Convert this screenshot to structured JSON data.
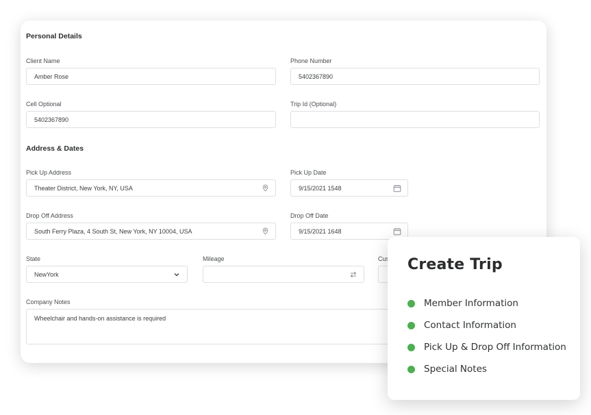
{
  "sections": {
    "personal": "Personal Details",
    "address": "Address & Dates"
  },
  "fields": {
    "client_name": {
      "label": "Client Name",
      "value": "Amber Rose"
    },
    "phone_number": {
      "label": "Phone Number",
      "value": "5402367890"
    },
    "cell_optional": {
      "label": "Cell Optional",
      "value": "5402367890"
    },
    "trip_id": {
      "label": "Trip Id (Optional)",
      "value": ""
    },
    "pickup_address": {
      "label": "Pick Up Address",
      "value": "Theater District, New York, NY, USA",
      "icon": "location-pin-icon"
    },
    "pickup_date": {
      "label": "Pick Up Date",
      "value": "9/15/2021 1548",
      "icon": "calendar-icon"
    },
    "dropoff_address": {
      "label": "Drop Off Address",
      "value": "South Ferry Plaza, 4 South St, New York, NY 10004, USA",
      "icon": "location-pin-icon"
    },
    "dropoff_date": {
      "label": "Drop Off Date",
      "value": "9/15/2021 1648",
      "icon": "calendar-icon"
    },
    "state": {
      "label": "State",
      "value": "NewYork",
      "icon": "chevron-down-icon"
    },
    "mileage": {
      "label": "Mileage",
      "value": "",
      "icon": "swap-icon"
    },
    "partial_field": {
      "label": "Cus",
      "value": ""
    },
    "company_notes": {
      "label": "Company Notes",
      "value": "Wheelchair and hands-on assistance is required"
    }
  },
  "popup": {
    "title": "Create Trip",
    "steps": [
      {
        "label": "Member Information"
      },
      {
        "label": "Contact Information"
      },
      {
        "label": "Pick Up & Drop Off Information"
      },
      {
        "label": "Special Notes"
      }
    ],
    "accent": "#4caf50"
  },
  "colors": {
    "border": "#dcdfe3",
    "icon": "#8a8f95"
  }
}
